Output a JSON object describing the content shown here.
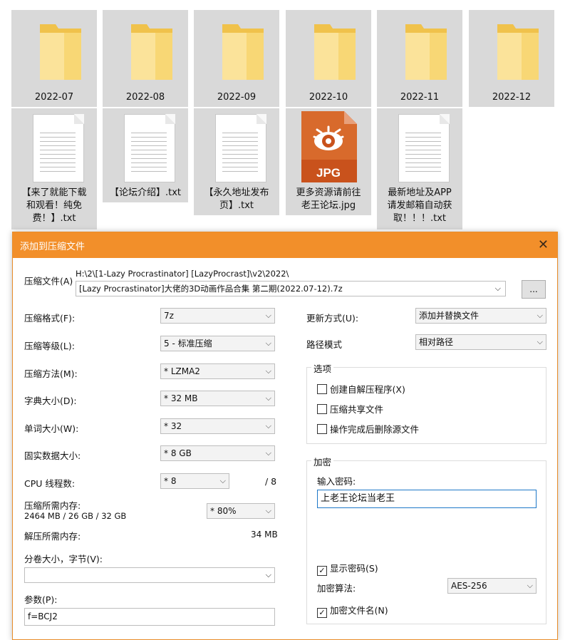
{
  "colors": {
    "titlebar": "#f28f2a",
    "folder": "#f8d775",
    "jpg_accent": "#d94e1f"
  },
  "explorer": {
    "items": [
      {
        "name": "2022-07",
        "type": "folder"
      },
      {
        "name": "2022-08",
        "type": "folder"
      },
      {
        "name": "2022-09",
        "type": "folder"
      },
      {
        "name": "2022-10",
        "type": "folder"
      },
      {
        "name": "2022-11",
        "type": "folder"
      },
      {
        "name": "2022-12",
        "type": "folder"
      },
      {
        "name_lines": [
          "【来了就能下载",
          "和观看！纯免",
          "费！】.txt"
        ],
        "type": "txt"
      },
      {
        "name_lines": [
          "【论坛介绍】.txt"
        ],
        "type": "txt"
      },
      {
        "name_lines": [
          "【永久地址发布",
          "页】.txt"
        ],
        "type": "txt"
      },
      {
        "name_lines": [
          "更多资源请前往",
          "老王论坛.jpg"
        ],
        "type": "jpg",
        "badge": "JPG"
      },
      {
        "name_lines": [
          "最新地址及APP",
          "请发邮箱自动获",
          "取！！！.txt"
        ],
        "type": "txt"
      }
    ]
  },
  "dialog": {
    "title": "添加到压缩文件",
    "archive_label": "压缩文件(A)",
    "archive_path": "H:\\2\\[1-Lazy Procrastinator] [LazyProcrast]\\v2\\2022\\",
    "archive_name": "[Lazy Procrastinator]大佬的3D动画作品合集 第二期(2022.07-12).7z",
    "browse_label": "...",
    "format_label": "压缩格式(F):",
    "format_value": "7z",
    "level_label": "压缩等级(L):",
    "level_value": "5 - 标准压缩",
    "method_label": "压缩方法(M):",
    "method_value": "* LZMA2",
    "dict_label": "字典大小(D):",
    "dict_value": "* 32 MB",
    "word_label": "单词大小(W):",
    "word_value": "* 32",
    "solid_label": "固实数据大小:",
    "solid_value": "* 8 GB",
    "cpu_label": "CPU 线程数:",
    "cpu_value": "* 8",
    "cpu_max": "/ 8",
    "mem_label": "压缩所需内存:",
    "mem_info": "2464 MB / 26 GB / 32 GB",
    "mem_value": "* 80%",
    "decomp_label": "解压所需内存:",
    "decomp_value": "34 MB",
    "split_label": "分卷大小，字节(V):",
    "split_value": "",
    "params_label": "参数(P):",
    "params_value": "f=BCJ2",
    "update_label": "更新方式(U):",
    "update_value": "添加并替换文件",
    "path_label": "路径模式",
    "path_value": "相对路径",
    "options_title": "选项",
    "opt_sfx": "创建自解压程序(X)",
    "opt_shared": "压缩共享文件",
    "opt_delete": "操作完成后删除源文件",
    "encrypt_title": "加密",
    "password_label": "输入密码:",
    "password_value": "上老王论坛当老王",
    "show_password": "显示密码(S)",
    "check_mark": "✓",
    "algo_label": "加密算法:",
    "algo_value": "AES-256",
    "encrypt_names": "加密文件名(N)",
    "close_glyph": "✕",
    "arrow_glyph": "⌵"
  }
}
